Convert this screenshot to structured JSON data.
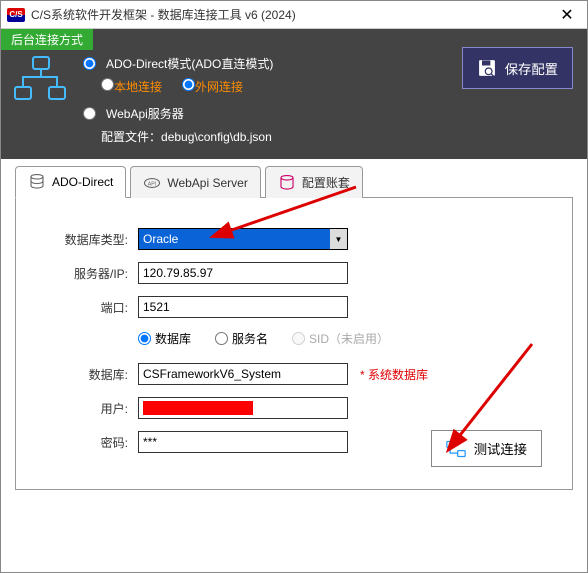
{
  "window": {
    "icon_text": "C/S",
    "title": "C/S系统软件开发框架 - 数据库连接工具 v6 (2024)"
  },
  "topbar": {
    "green_label": "后台连接方式",
    "mode_ado": "ADO-Direct模式(ADO直连模式)",
    "local_conn": "本地连接",
    "external_conn": "外网连接",
    "mode_webapi": "WebApi服务器",
    "config_file_label": "配置文件：",
    "config_file_path": "debug\\config\\db.json",
    "save_btn": "保存配置"
  },
  "tabs": {
    "ado": "ADO-Direct",
    "webapi": "WebApi Server",
    "accounts": "配置账套"
  },
  "form": {
    "db_type_label": "数据库类型:",
    "db_type_value": "Oracle",
    "server_label": "服务器/IP:",
    "server_value": "120.79.85.97",
    "port_label": "端口:",
    "port_value": "1521",
    "r_db": "数据库",
    "r_service": "服务名",
    "r_sid": "SID（未启用）",
    "database_label": "数据库:",
    "database_value": "CSFrameworkV6_System",
    "database_note": "* 系统数据库",
    "user_label": "用户:",
    "password_label": "密码:",
    "password_value": "***",
    "test_btn": "测试连接"
  }
}
